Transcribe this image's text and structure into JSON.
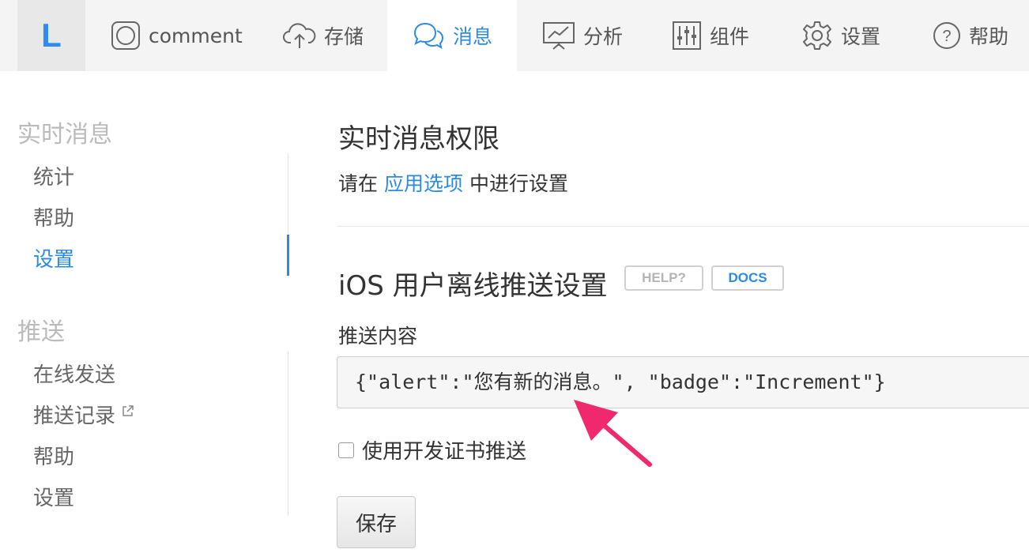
{
  "logo": {
    "letter": "L"
  },
  "nav": {
    "items": [
      {
        "label": "comment",
        "icon": "app-square-icon"
      },
      {
        "label": "存储",
        "icon": "cloud-upload-icon"
      },
      {
        "label": "消息",
        "icon": "chat-bubbles-icon",
        "active": true
      },
      {
        "label": "分析",
        "icon": "chart-presentation-icon"
      },
      {
        "label": "组件",
        "icon": "sliders-icon"
      },
      {
        "label": "设置",
        "icon": "gear-icon"
      },
      {
        "label": "帮助",
        "icon": "help-circle-icon"
      }
    ]
  },
  "sidebar": {
    "realtime": {
      "title": "实时消息",
      "items": [
        {
          "label": "统计"
        },
        {
          "label": "帮助"
        },
        {
          "label": "设置",
          "active": true
        }
      ]
    },
    "push": {
      "title": "推送",
      "items": [
        {
          "label": "在线发送"
        },
        {
          "label": "推送记录",
          "icon": "external-link-icon"
        },
        {
          "label": "帮助"
        },
        {
          "label": "设置"
        }
      ]
    }
  },
  "main": {
    "permission_title": "实时消息权限",
    "permission_prefix": "请在",
    "permission_link": "应用选项",
    "permission_suffix": "中进行设置",
    "ios_title": "iOS 用户离线推送设置",
    "help_tag": "HELP?",
    "docs_tag": "DOCS",
    "push_content_label": "推送内容",
    "push_content_value": "{\"alert\":\"您有新的消息。\", \"badge\":\"Increment\"}",
    "dev_cert_label": "使用开发证书推送",
    "dev_cert_checked": false,
    "save_button": "保存"
  },
  "colors": {
    "accent": "#2b8ae6",
    "annotation_arrow": "#f0286e",
    "nav_background": "#f4f4f4"
  }
}
